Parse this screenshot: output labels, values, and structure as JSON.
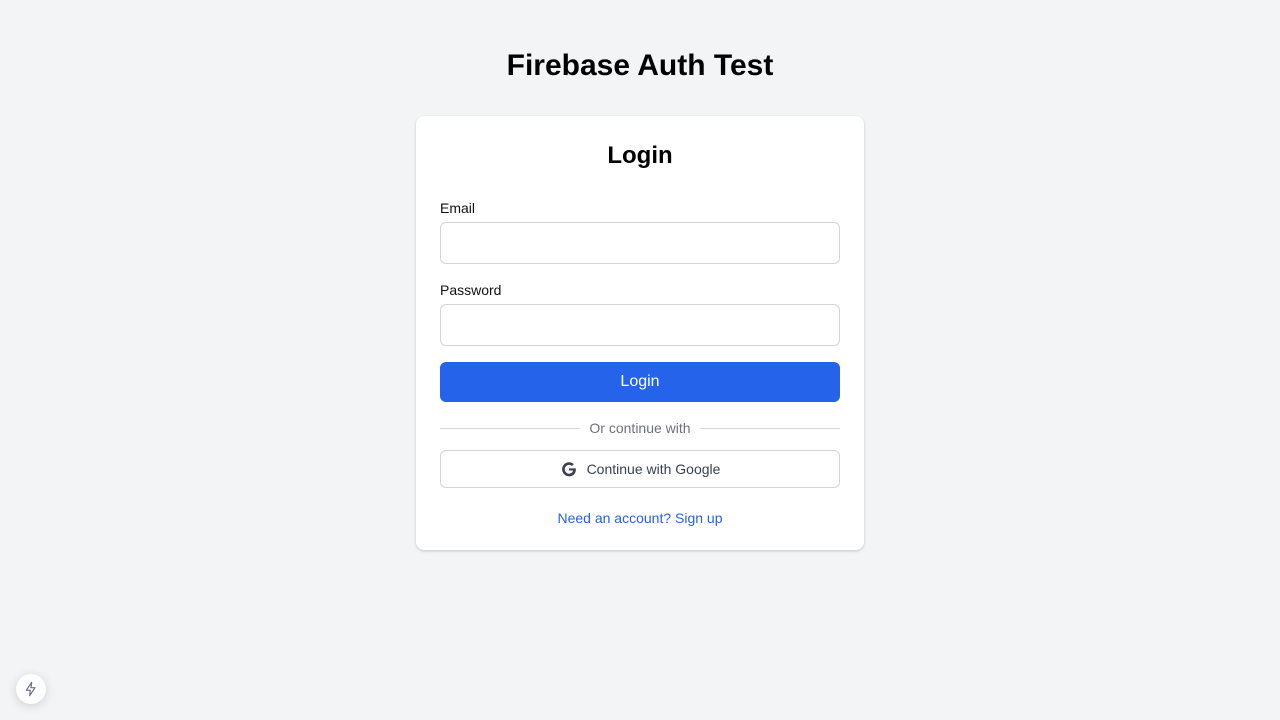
{
  "app": {
    "title": "Firebase Auth Test"
  },
  "login_form": {
    "title": "Login",
    "email_label": "Email",
    "email_value": "",
    "password_label": "Password",
    "password_value": "",
    "submit_label": "Login",
    "divider_text": "Or continue with",
    "google_label": "Continue with Google",
    "signup_link": "Need an account? Sign up"
  },
  "icons": {
    "google": "google-icon",
    "dev_badge": "lightning-bolt-icon"
  },
  "colors": {
    "primary": "#2563eb",
    "background": "#f3f4f6",
    "card": "#ffffff",
    "border": "#d1d5db",
    "muted_text": "#6b7280"
  }
}
